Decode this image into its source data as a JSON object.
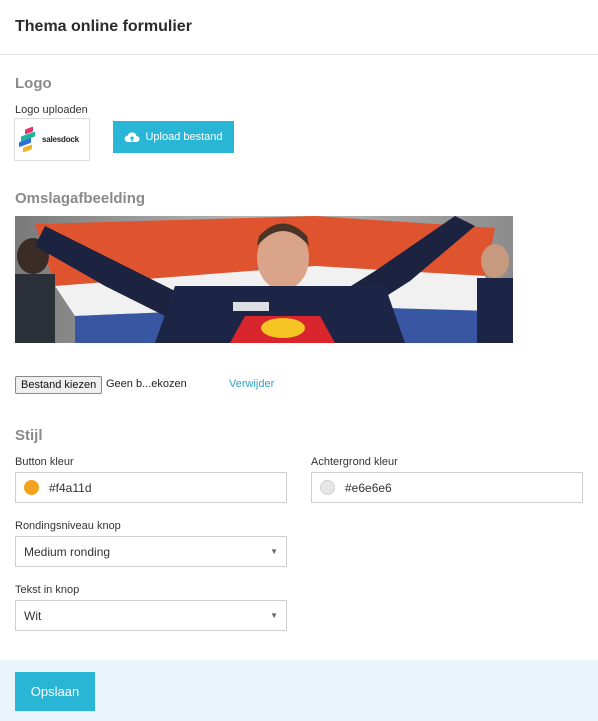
{
  "header": {
    "title": "Thema online formulier"
  },
  "logo": {
    "section_title": "Logo",
    "upload_label": "Logo uploaden",
    "logo_text": "salesdock",
    "upload_button": "Upload bestand",
    "upload_icon": "cloud-upload-icon"
  },
  "cover": {
    "section_title": "Omslagafbeelding",
    "file_button": "Bestand kiezen",
    "file_name": "Geen b...ekozen",
    "remove_link": "Verwijder"
  },
  "style": {
    "section_title": "Stijl",
    "button_color_label": "Button kleur",
    "button_color_value": "#f4a11d",
    "background_color_label": "Achtergrond kleur",
    "background_color_value": "#e6e6e6",
    "rounding_label": "Rondingsniveau knop",
    "rounding_value": "Medium ronding",
    "text_label": "Tekst in knop",
    "text_value": "Wit"
  },
  "footer": {
    "save_button": "Opslaan"
  },
  "colors": {
    "accent": "#29b6d6",
    "footer_bg": "#eaf4fb",
    "link": "#29a3c9"
  }
}
